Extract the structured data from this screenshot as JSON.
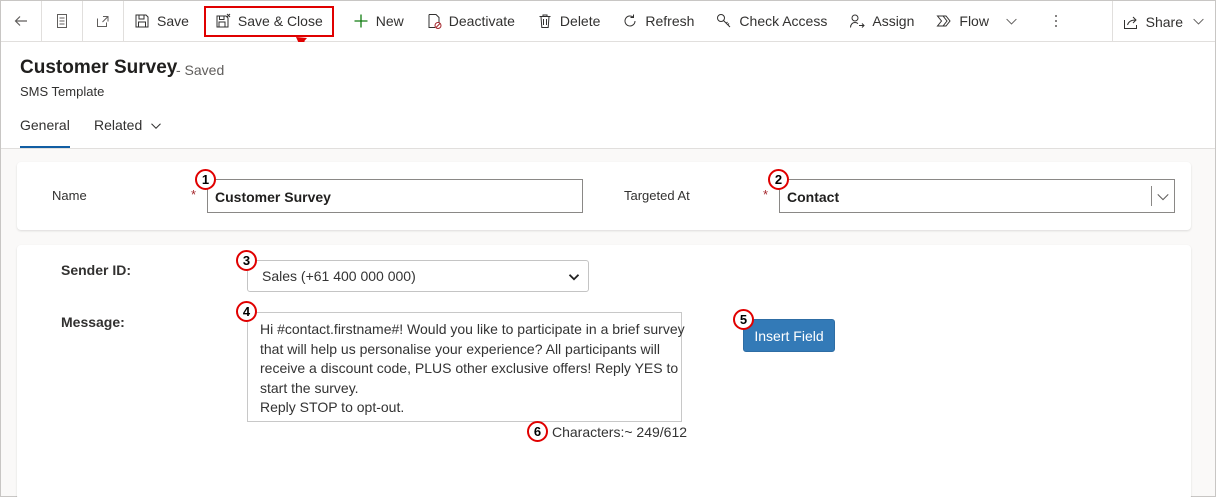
{
  "toolbar": {
    "save_label": "Save",
    "save_close_label": "Save & Close",
    "new_label": "New",
    "deactivate_label": "Deactivate",
    "delete_label": "Delete",
    "refresh_label": "Refresh",
    "check_access_label": "Check Access",
    "assign_label": "Assign",
    "flow_label": "Flow",
    "share_label": "Share"
  },
  "record": {
    "title": "Customer Survey",
    "status": "- Saved",
    "entity": "SMS Template"
  },
  "tabs": [
    {
      "label": "General",
      "active": true
    },
    {
      "label": "Related",
      "active": false
    }
  ],
  "form": {
    "name_label": "Name",
    "name_required": "*",
    "name_value": "Customer Survey",
    "targeted_label": "Targeted At",
    "targeted_required": "*",
    "targeted_value": "Contact"
  },
  "sms": {
    "sender_label": "Sender ID:",
    "sender_value": "Sales (+61 400 000 000)",
    "message_label": "Message:",
    "message_lines": [
      "Hi #contact.firstname#! Would you like to participate in a brief survey",
      "that will help us personalise your experience? All participants will",
      "receive a discount code, PLUS other exclusive offers! Reply YES to",
      "start the survey.",
      "Reply STOP to opt-out."
    ],
    "insert_field_label": "Insert Field",
    "char_count": "Characters:~ 249/612"
  },
  "markers": [
    "1",
    "2",
    "3",
    "4",
    "5",
    "6"
  ],
  "colors": {
    "callout": "#e00000",
    "accent": "#115ea3",
    "insert_button": "#337ab7"
  }
}
